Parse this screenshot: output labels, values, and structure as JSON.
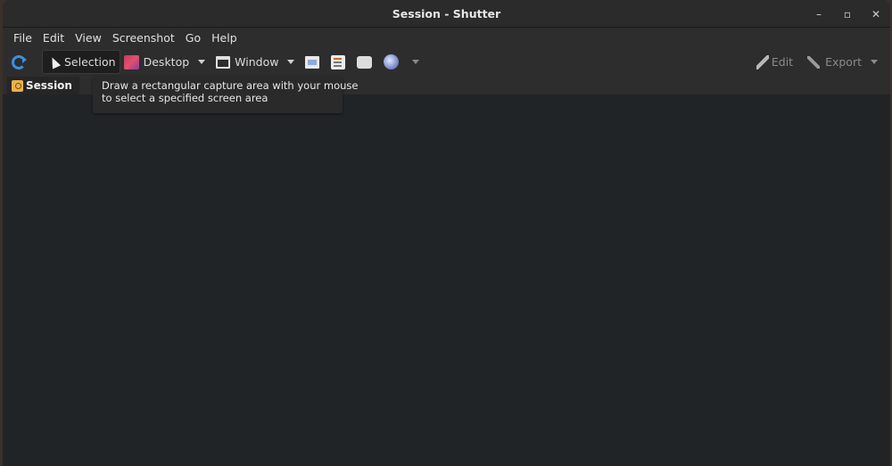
{
  "window": {
    "title": "Session - Shutter",
    "controls": [
      "minimize-icon",
      "maximize-icon",
      "close-icon"
    ]
  },
  "menu": {
    "items": [
      "File",
      "Edit",
      "View",
      "Screenshot",
      "Go",
      "Help"
    ]
  },
  "toolbar": {
    "refresh_icon": "refresh-icon",
    "selection_label": "Selection",
    "desktop_label": "Desktop",
    "window_label": "Window",
    "edit_label": "Edit",
    "export_label": "Export"
  },
  "tooltip": {
    "line1": "Draw a rectangular capture area with your mouse",
    "line2": "to select a specified screen area"
  },
  "tabs": [
    {
      "label": "Session"
    }
  ]
}
